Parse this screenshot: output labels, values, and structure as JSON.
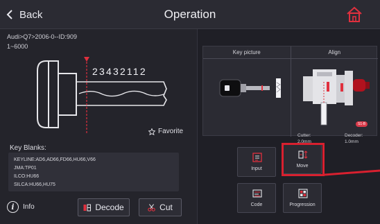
{
  "header": {
    "back_label": "Back",
    "title": "Operation"
  },
  "key_info": {
    "path": "Audi>Q7>2006-0--ID:909",
    "range": "1~6000",
    "cut_code": "23432112",
    "favorite_label": "Favorite"
  },
  "key_blanks": {
    "label": "Key Blanks:",
    "lines": [
      "KEYLINE:AD6,AD66,FD66,HU66,V66",
      "JMA:TP01",
      "ILCO:HU66",
      "SILCA:HU66,HU75"
    ]
  },
  "bottom": {
    "info_label": "Info",
    "decode_label": "Decode",
    "cut_label": "Cut"
  },
  "panel": {
    "key_picture_label": "Key picture",
    "align_label": "Align",
    "badge": "S1-B",
    "cutter_label": "Cutter:",
    "cutter_value": "2.0mm",
    "decoder_label": "Decoder:",
    "decoder_value": "1.0mm"
  },
  "tiles": {
    "input_label": "Input",
    "move_label": "Move",
    "code_label": "Code",
    "progression_label": "Progression"
  },
  "colors": {
    "accent_red": "#d8202f",
    "background": "#1c1c22",
    "panel": "#2b2b33"
  }
}
